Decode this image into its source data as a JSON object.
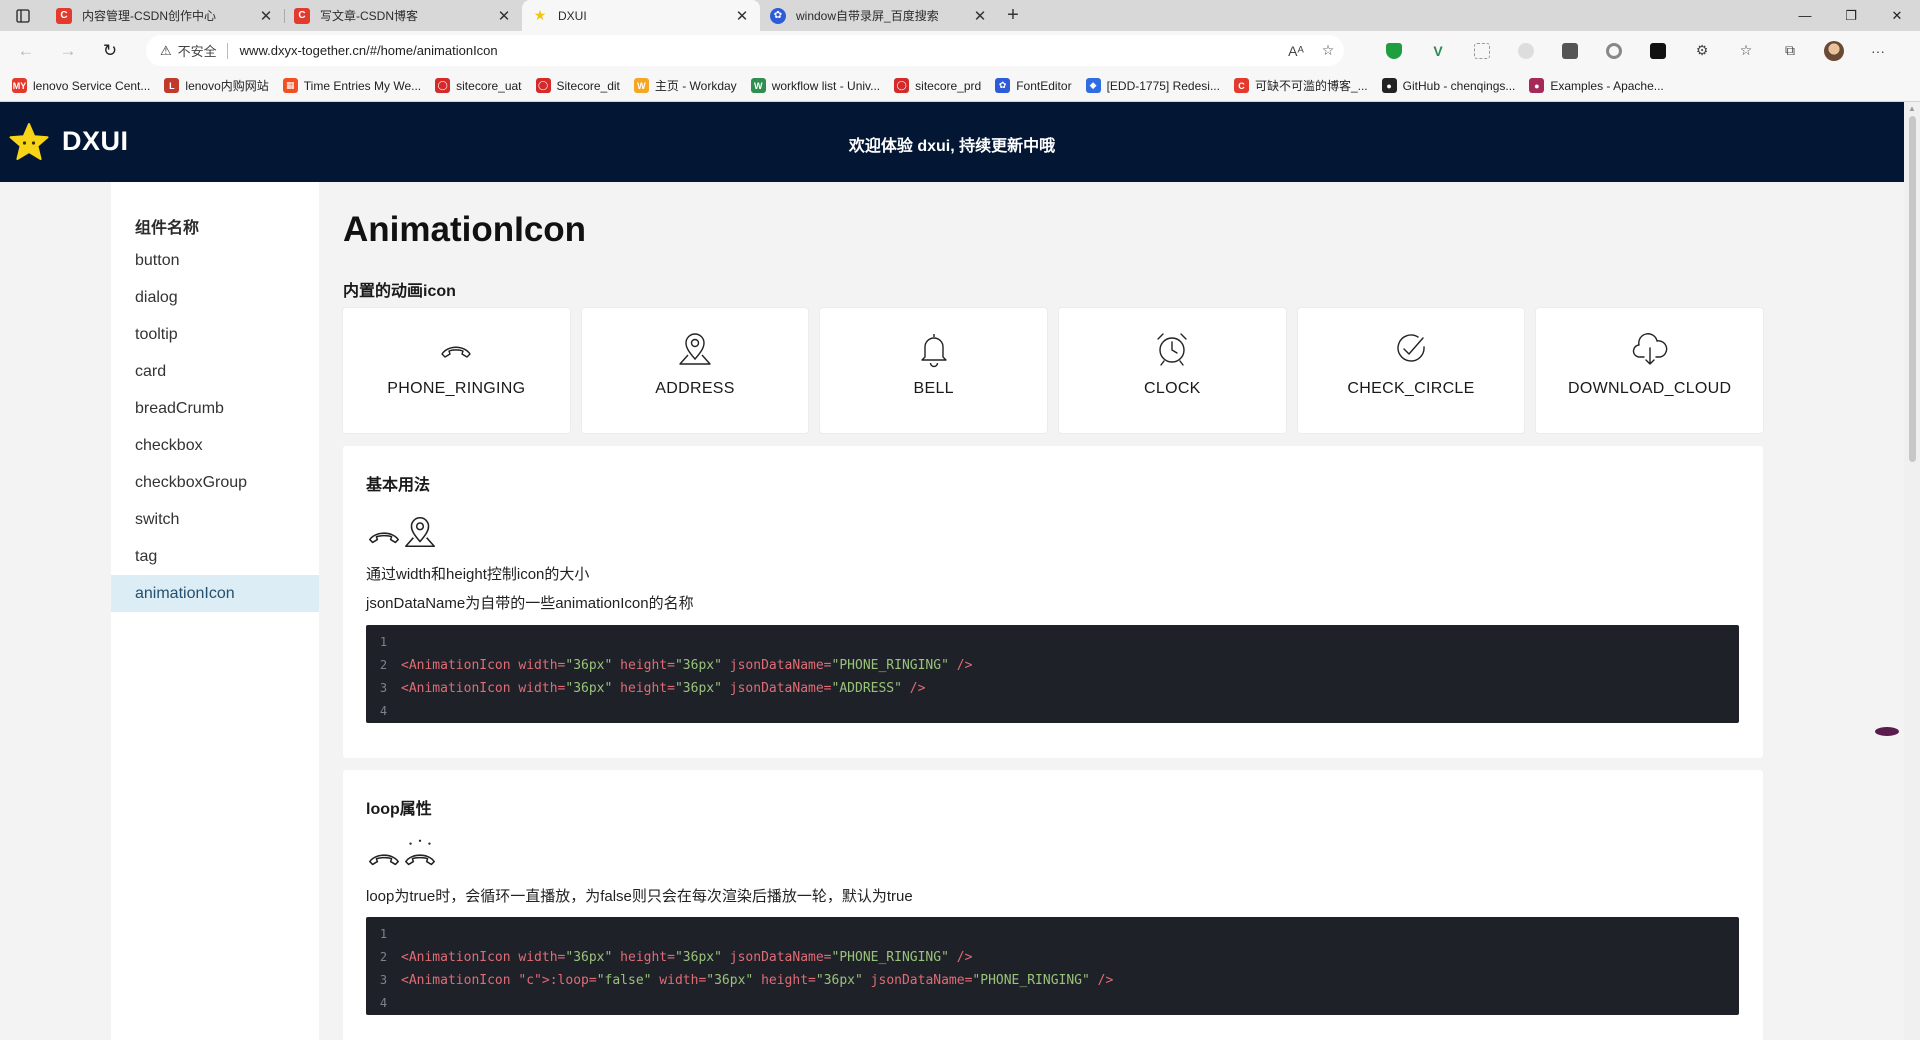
{
  "browser": {
    "tabs": [
      {
        "title": "内容管理-CSDN创作中心",
        "favicon": "C"
      },
      {
        "title": "写文章-CSDN博客",
        "favicon": "C"
      },
      {
        "title": "DXUI",
        "favicon": "★"
      },
      {
        "title": "window自带录屏_百度搜索",
        "favicon": "✿"
      }
    ],
    "insecure_label": "不安全",
    "url": "www.dxyx-together.cn/#/home/animationIcon",
    "bookmarks": [
      {
        "label": "lenovo Service Cent...",
        "icon": "MY",
        "color": "#e23b2e"
      },
      {
        "label": "lenovo内购网站",
        "icon": "L",
        "color": "#c0392b"
      },
      {
        "label": "Time Entries My We...",
        "icon": "▦",
        "color": "#f25022"
      },
      {
        "label": "sitecore_uat",
        "icon": "◯",
        "color": "#d42a2a"
      },
      {
        "label": "Sitecore_dit",
        "icon": "◯",
        "color": "#d42a2a"
      },
      {
        "label": "主页 - Workday",
        "icon": "W",
        "color": "#f5a623"
      },
      {
        "label": "workflow list - Univ...",
        "icon": "W",
        "color": "#2f8f4e"
      },
      {
        "label": "sitecore_prd",
        "icon": "◯",
        "color": "#d42a2a"
      },
      {
        "label": "FontEditor",
        "icon": "✿",
        "color": "#2e5bd8"
      },
      {
        "label": "[EDD-1775] Redesi...",
        "icon": "◆",
        "color": "#2f6de1"
      },
      {
        "label": "可缺不可滥的博客_...",
        "icon": "C",
        "color": "#e23b2e"
      },
      {
        "label": "GitHub - chenqings...",
        "icon": "●",
        "color": "#222222"
      },
      {
        "label": "Examples - Apache...",
        "icon": "●",
        "color": "#a52a5a"
      }
    ]
  },
  "header": {
    "logo_text": "DXUI",
    "welcome": "欢迎体验 dxui, 持续更新中哦"
  },
  "sidebar": {
    "group_title": "组件名称",
    "items": [
      "button",
      "dialog",
      "tooltip",
      "card",
      "breadCrumb",
      "checkbox",
      "checkboxGroup",
      "switch",
      "tag",
      "animationIcon"
    ],
    "active": "animationIcon"
  },
  "main": {
    "title": "AnimationIcon",
    "builtin_title": "内置的动画icon",
    "icons": [
      {
        "name": "PHONE_RINGING",
        "icon": "phone-ringing-icon"
      },
      {
        "name": "ADDRESS",
        "icon": "address-pin-icon"
      },
      {
        "name": "BELL",
        "icon": "bell-icon"
      },
      {
        "name": "CLOCK",
        "icon": "alarm-clock-icon"
      },
      {
        "name": "CHECK_CIRCLE",
        "icon": "check-circle-icon"
      },
      {
        "name": "DOWNLOAD_CLOUD",
        "icon": "download-cloud-icon"
      }
    ],
    "basic": {
      "title": "基本用法",
      "desc1": "通过width和height控制icon的大小",
      "desc2": "jsonDataName为自带的一些animationIcon的名称",
      "code": [
        "",
        "<AnimationIcon width=\"36px\" height=\"36px\" jsonDataName=\"PHONE_RINGING\" />",
        "<AnimationIcon width=\"36px\" height=\"36px\" jsonDataName=\"ADDRESS\" />",
        ""
      ]
    },
    "loop": {
      "title": "loop属性",
      "desc": "loop为true时，会循环一直播放，为false则只会在每次渲染后播放一轮，默认为true",
      "code": [
        "",
        "<AnimationIcon width=\"36px\" height=\"36px\" jsonDataName=\"PHONE_RINGING\" />",
        "<AnimationIcon :loop=\"false\" width=\"36px\" height=\"36px\" jsonDataName=\"PHONE_RINGING\" />",
        ""
      ]
    }
  }
}
